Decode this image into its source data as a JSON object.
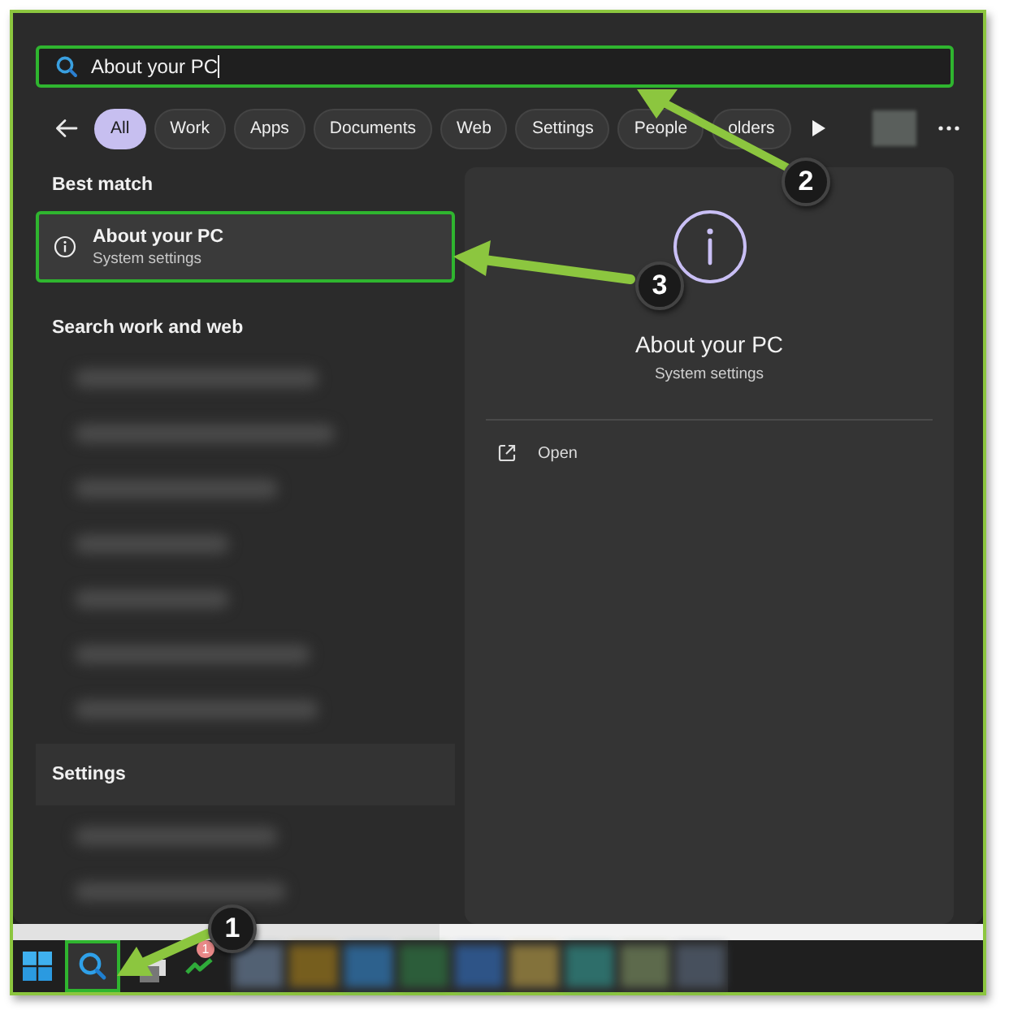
{
  "search": {
    "value": "About your PC"
  },
  "filters": [
    {
      "label": "All",
      "selected": true
    },
    {
      "label": "Work",
      "selected": false
    },
    {
      "label": "Apps",
      "selected": false
    },
    {
      "label": "Documents",
      "selected": false
    },
    {
      "label": "Web",
      "selected": false
    },
    {
      "label": "Settings",
      "selected": false
    },
    {
      "label": "People",
      "selected": false
    },
    {
      "label": "olders",
      "selected": false
    }
  ],
  "best_match": {
    "heading": "Best match",
    "item": {
      "title": "About your PC",
      "subtitle": "System settings",
      "selected": true
    }
  },
  "search_web": {
    "heading": "Search work and web"
  },
  "settings_section": {
    "heading": "Settings"
  },
  "preview": {
    "title": "About your PC",
    "subtitle": "System settings",
    "actions": [
      {
        "label": "Open"
      }
    ]
  },
  "taskbar": {
    "notification_badge": "1"
  },
  "callouts": [
    {
      "number": "1"
    },
    {
      "number": "2"
    },
    {
      "number": "3"
    }
  ]
}
